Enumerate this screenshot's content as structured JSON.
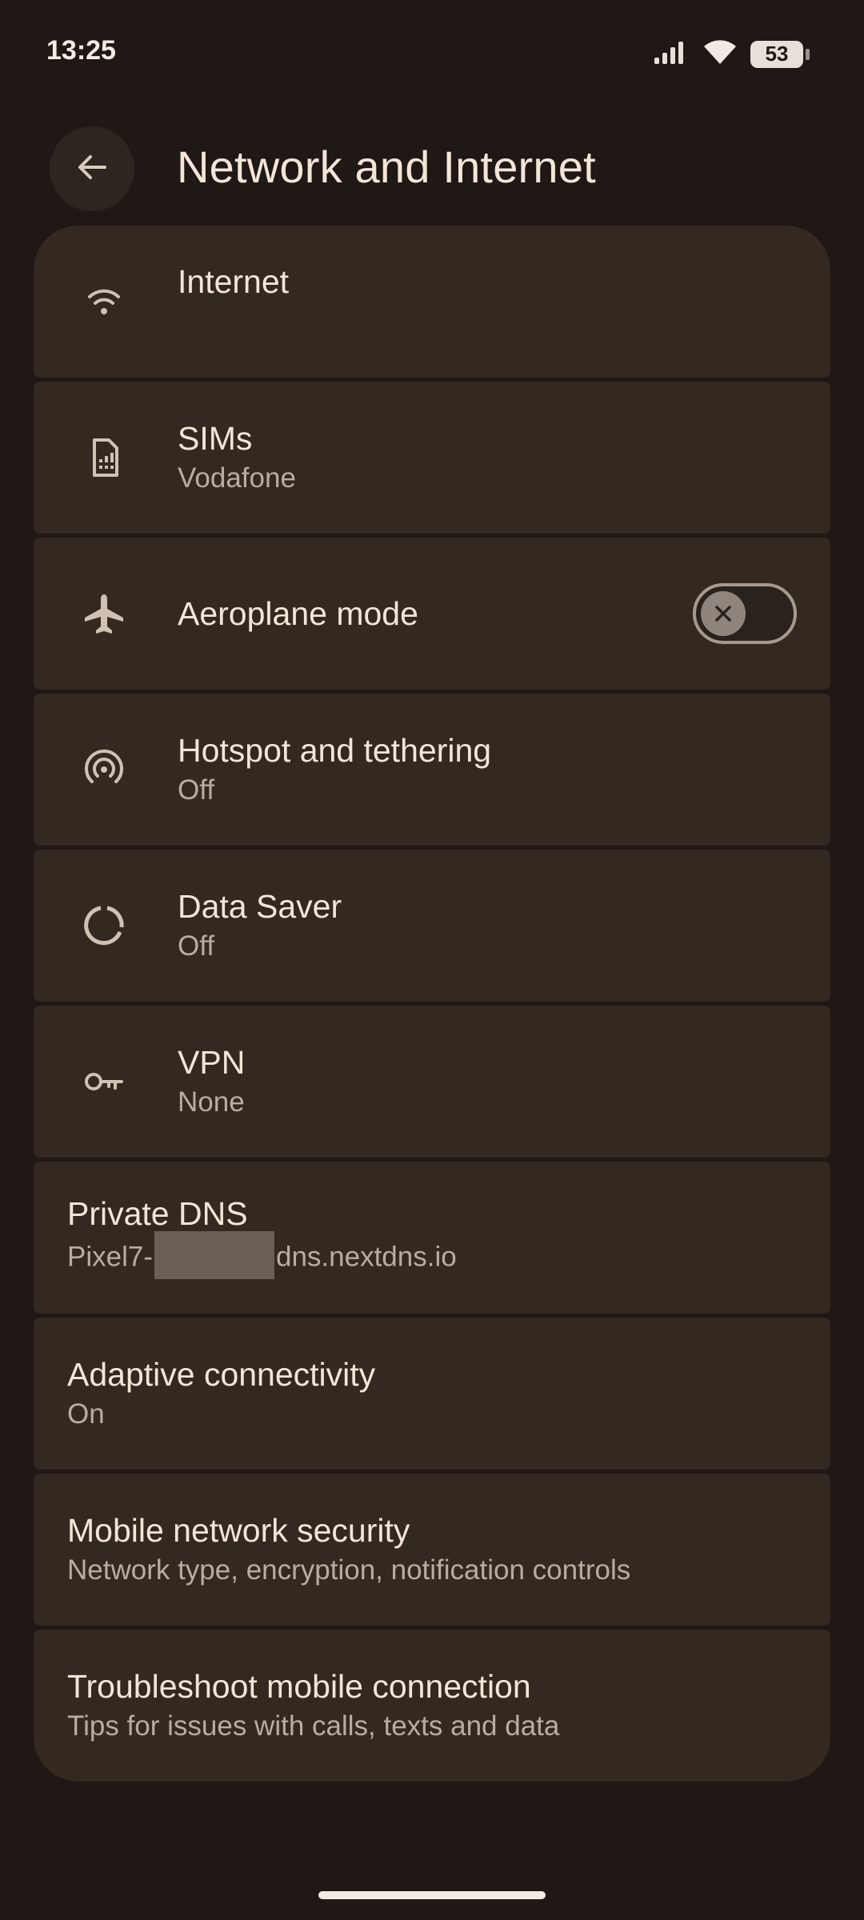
{
  "status_bar": {
    "time": "13:25",
    "battery": "53",
    "icons": [
      "signal-icon",
      "wifi-icon",
      "battery-icon"
    ]
  },
  "header": {
    "title": "Network and Internet",
    "back_icon": "arrow-left-icon"
  },
  "items": [
    {
      "id": "internet",
      "title": "Internet",
      "subtitle": "",
      "icon": "wifi-icon"
    },
    {
      "id": "sims",
      "title": "SIMs",
      "subtitle": "Vodafone",
      "icon": "sim-card-icon"
    },
    {
      "id": "aeroplane",
      "title": "Aeroplane mode",
      "subtitle": "",
      "icon": "airplane-icon",
      "toggle": "off"
    },
    {
      "id": "hotspot",
      "title": "Hotspot and tethering",
      "subtitle": "Off",
      "icon": "hotspot-icon"
    },
    {
      "id": "datasaver",
      "title": "Data Saver",
      "subtitle": "Off",
      "icon": "data-saver-icon"
    },
    {
      "id": "vpn",
      "title": "VPN",
      "subtitle": "None",
      "icon": "key-icon"
    },
    {
      "id": "privatedns",
      "title": "Private DNS",
      "subtitle_prefix": "Pixel7-",
      "subtitle_suffix": "dns.nextdns.io"
    },
    {
      "id": "adaptive",
      "title": "Adaptive connectivity",
      "subtitle": "On"
    },
    {
      "id": "security",
      "title": "Mobile network security",
      "subtitle": "Network type, encryption, notification controls"
    },
    {
      "id": "troubleshoot",
      "title": "Troubleshoot mobile connection",
      "subtitle": "Tips for issues with calls, texts and data"
    }
  ],
  "colors": {
    "background": "#1f1814",
    "card": "#332920",
    "text_primary": "#f3e5d8",
    "text_secondary": "#b9aca0"
  }
}
